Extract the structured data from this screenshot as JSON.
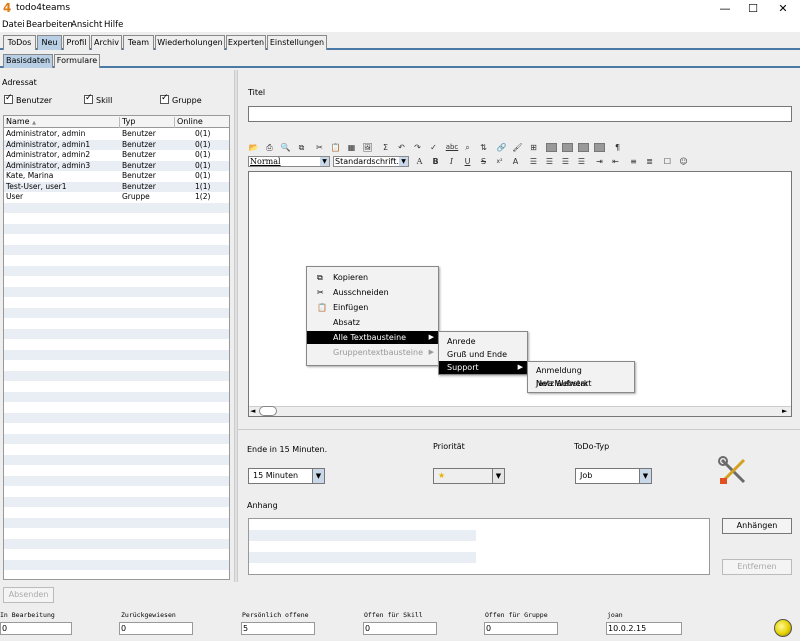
{
  "window": {
    "title": "todo4teams",
    "logo_glyph": "4"
  },
  "menubar": [
    {
      "label": "Datei"
    },
    {
      "label": "Bearbeiten"
    },
    {
      "label": "Ansicht"
    },
    {
      "label": "Hilfe"
    }
  ],
  "main_tabs": [
    {
      "label": "ToDos"
    },
    {
      "label": "Neu",
      "active": true
    },
    {
      "label": "Profil"
    },
    {
      "label": "Archiv"
    },
    {
      "label": "Team"
    },
    {
      "label": "Wiederholungen"
    },
    {
      "label": "Experten"
    },
    {
      "label": "Einstellungen"
    }
  ],
  "sub_tabs": [
    {
      "label": "Basisdaten",
      "active": true
    },
    {
      "label": "Formulare"
    }
  ],
  "recipient": {
    "label": "Adressat",
    "filters": [
      {
        "label": "Benutzer",
        "checked": true
      },
      {
        "label": "Skill",
        "checked": true
      },
      {
        "label": "Gruppe",
        "checked": true
      }
    ],
    "columns": [
      "Name",
      "Typ",
      "Online"
    ],
    "sort_indicator": "▲",
    "rows": [
      [
        "Administrator, admin",
        "Benutzer",
        "0(1)"
      ],
      [
        "Administrator, admin1",
        "Benutzer",
        "0(1)"
      ],
      [
        "Administrator, admin2",
        "Benutzer",
        "0(1)"
      ],
      [
        "Administrator, admin3",
        "Benutzer",
        "0(1)"
      ],
      [
        "Kate, Marina",
        "Benutzer",
        "0(1)"
      ],
      [
        "Test-User, user1",
        "Benutzer",
        "1(1)"
      ],
      [
        "User",
        "Gruppe",
        "1(2)"
      ]
    ]
  },
  "send_button": {
    "label": "Absenden"
  },
  "title_field": {
    "label": "Titel",
    "value": ""
  },
  "editor": {
    "style_select": "Normal",
    "font_select": "Standardschrift...",
    "context_menu": {
      "items": [
        {
          "label": "Kopieren",
          "icon": "copy-icon"
        },
        {
          "label": "Ausschneiden",
          "icon": "scissors-icon"
        },
        {
          "label": "Einfügen",
          "icon": "paste-icon"
        },
        {
          "label": "Absatz"
        },
        {
          "label": "Alle Textbausteine",
          "selected": true,
          "submenu": true
        },
        {
          "label": "Gruppentextbausteine",
          "disabled": true,
          "submenu": true
        }
      ],
      "submenu": [
        {
          "label": "Anrede"
        },
        {
          "label": "Gruß und Ende"
        },
        {
          "label": "Support",
          "selected": true,
          "submenu": true
        }
      ],
      "submenu2": [
        {
          "label": "Anmeldung Netzlaufwerk"
        },
        {
          "label": "Java Webstart"
        }
      ]
    }
  },
  "deadline": {
    "label": "Ende in 15 Minuten.",
    "value": "15 Minuten"
  },
  "priority": {
    "label": "Priorität",
    "value": "★"
  },
  "todo_type": {
    "label": "ToDo-Typ",
    "value": "Job"
  },
  "attachment": {
    "label": "Anhang",
    "add_label": "Anhängen",
    "remove_label": "Entfernen"
  },
  "status": [
    {
      "label": "In Bearbeitung",
      "value": "0"
    },
    {
      "label": "Zurückgewiesen",
      "value": "0"
    },
    {
      "label": "Persönlich offene",
      "value": "5"
    },
    {
      "label": "Offen für Skill",
      "value": "0"
    },
    {
      "label": "Offen für Gruppe",
      "value": "0"
    },
    {
      "label": "joan",
      "value": "10.0.2.15"
    }
  ],
  "colors": {
    "accent": "#4a79a8",
    "tab_active": "#b8cfe5",
    "stripe": "#e9eef4"
  }
}
